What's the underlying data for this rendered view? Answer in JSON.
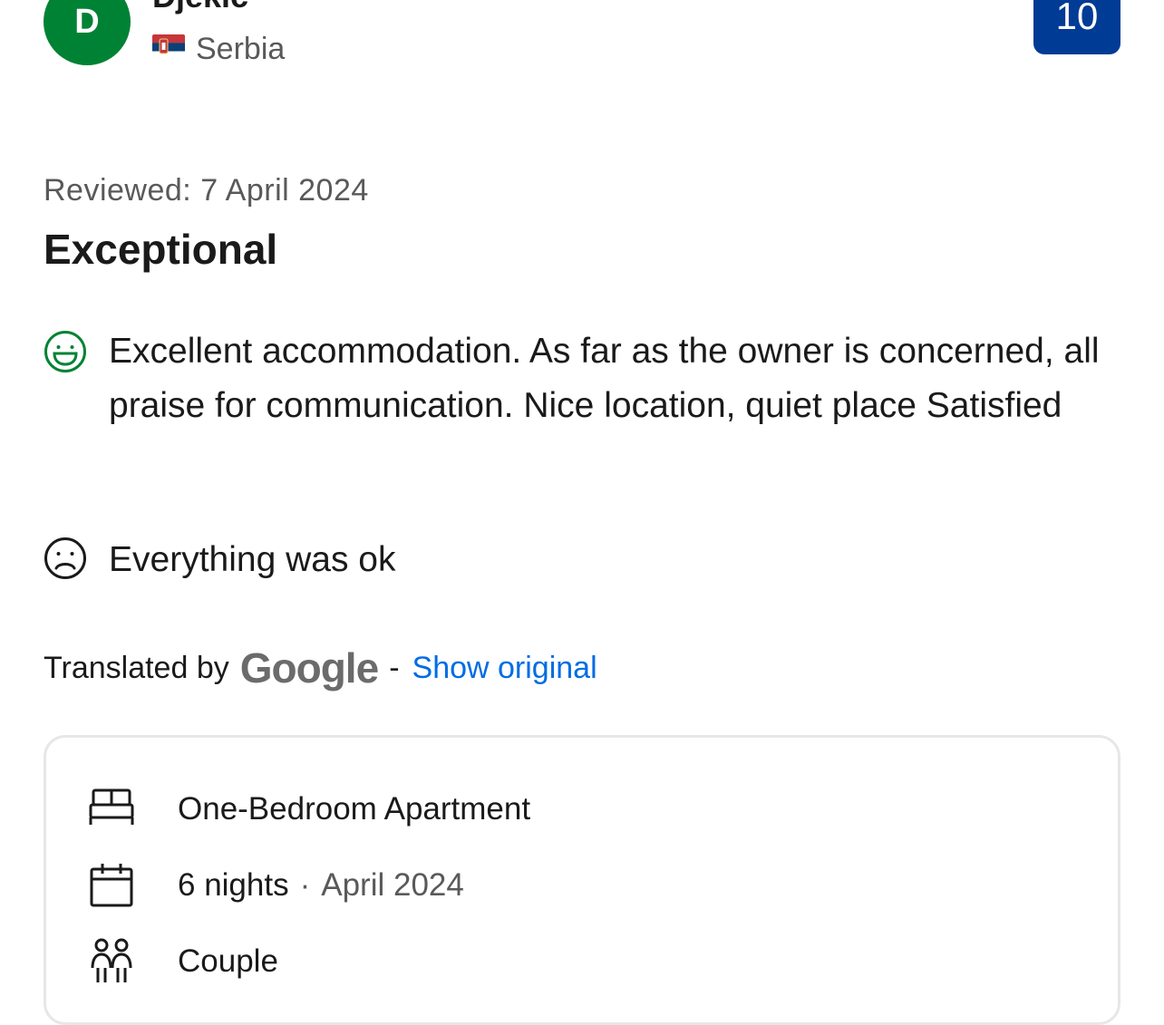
{
  "reviewer": {
    "initial": "D",
    "name": "Djekic",
    "country": "Serbia"
  },
  "score": "10",
  "review": {
    "date_label": "Reviewed: 7 April 2024",
    "title": "Exceptional",
    "positive": "Excellent accommodation. As far as the owner is concerned, all praise for communication. Nice location, quiet place Satisfied",
    "negative": "Everything was ok"
  },
  "translation": {
    "prefix": "Translated by",
    "brand": "Google",
    "separator": "-",
    "show_original": "Show original"
  },
  "stay": {
    "room": "One-Bedroom Apartment",
    "nights": "6 nights",
    "dot": "·",
    "month": "April 2024",
    "traveler_type": "Couple"
  },
  "colors": {
    "avatar": "#008234",
    "score_badge": "#003b95",
    "link": "#006ce4",
    "positive_icon": "#008234"
  }
}
